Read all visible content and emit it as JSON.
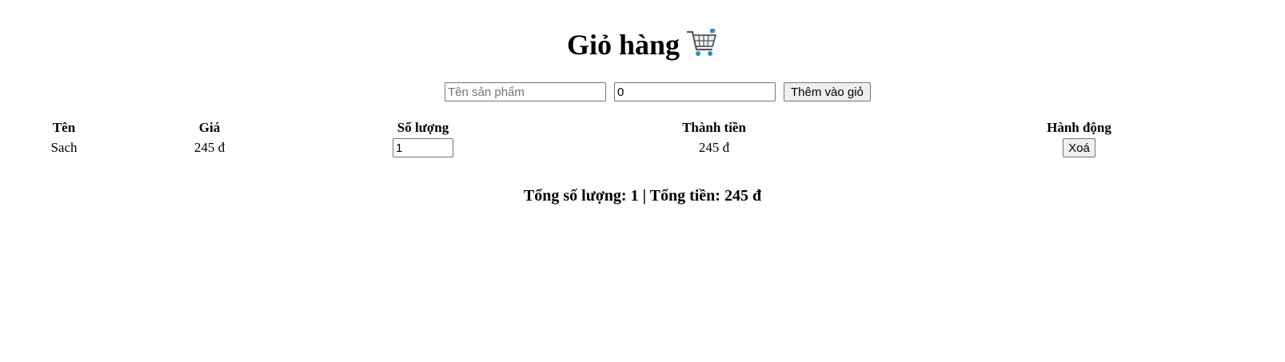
{
  "header": {
    "title": "Giỏ hàng",
    "icon": "shopping-cart-icon"
  },
  "add_form": {
    "name_placeholder": "Tên sản phẩm",
    "name_value": "",
    "price_value": "0",
    "add_label": "Thêm vào giỏ"
  },
  "table": {
    "headers": [
      "Tên",
      "Giá",
      "Số lượng",
      "Thành tiền",
      "Hành động"
    ],
    "rows": [
      {
        "name": "Sach",
        "price": "245 đ",
        "quantity": "1",
        "total": "245 đ",
        "action_label": "Xoá"
      }
    ]
  },
  "summary": {
    "text": "Tổng số lượng: 1 | Tổng tiền: 245 đ"
  }
}
